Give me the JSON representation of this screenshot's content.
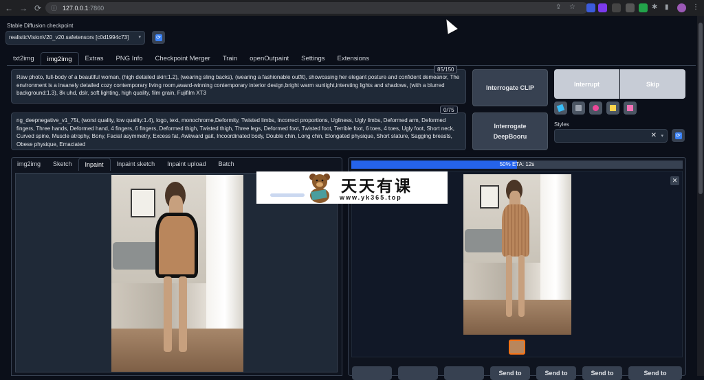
{
  "browser": {
    "url_host": "127.0.0.1",
    "url_port": ":7860"
  },
  "checkpoint": {
    "label": "Stable Diffusion checkpoint",
    "value": "realisticVisionV20_v20.safetensors [c0d1994c73]"
  },
  "main_tabs": [
    "txt2img",
    "img2img",
    "Extras",
    "PNG Info",
    "Checkpoint Merger",
    "Train",
    "openOutpaint",
    "Settings",
    "Extensions"
  ],
  "prompt": {
    "text": "Raw photo, full-body of a beautiful woman, (high detailed skin:1.2), (wearing sling backs), (wearing a fashionable outfit), showcasing her elegant posture and confident demeanor, The environment is a insanely detailed cozy contemporary living room,award-winning contemporary interior design,bright warm sunlight,intersting lights and shadows, (with a blurred background:1.3), 8k uhd, dslr, soft lighting, high quality, film grain, Fujifilm XT3",
    "token_count": "85/150"
  },
  "negative_prompt": {
    "text": "ng_deepnegative_v1_75t, (worst quality, low quality:1.4), logo, text, monochrome,Deformity, Twisted limbs, Incorrect proportions, Ugliness, Ugly limbs, Deformed arm, Deformed fingers, Three hands, Deformed hand, 4 fingers, 6 fingers, Deformed thigh, Twisted thigh, Three legs, Deformed foot, Twisted foot, Terrible foot, 6 toes, 4 toes, Ugly foot, Short neck, Curved spine, Muscle atrophy, Bony, Facial asymmetry, Excess fat, Awkward gait, Incoordinated body, Double chin, Long chin, Elongated physique, Short stature, Sagging breasts, Obese physique, Emaciated",
    "token_count": "0/75"
  },
  "buttons": {
    "interrogate_clip": "Interrogate CLIP",
    "interrogate_deepbooru": "Interrogate DeepBooru",
    "interrupt": "Interrupt",
    "skip": "Skip"
  },
  "styles": {
    "label": "Styles"
  },
  "sub_tabs": [
    "img2img",
    "Sketch",
    "Inpaint",
    "Inpaint sketch",
    "Inpaint upload",
    "Batch"
  ],
  "progress": {
    "fraction": 0.5,
    "text": "50% ETA: 12s"
  },
  "send_to": [
    "Send to",
    "Send to",
    "Send to",
    "Send to"
  ],
  "watermark": {
    "title": "天天有课",
    "url": "www.yk365.top"
  },
  "colors": {
    "background": "#0b0f19",
    "panel": "#1f2937",
    "accent_blue": "#2563eb",
    "thumb_border": "#f97316"
  }
}
